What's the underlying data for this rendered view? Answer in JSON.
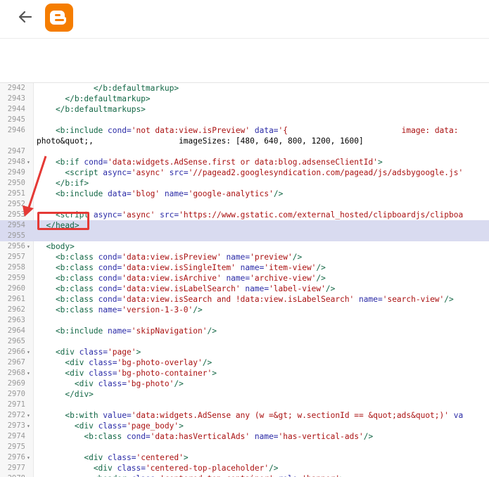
{
  "header": {
    "back_icon": "arrow-left-icon",
    "logo_icon": "blogger-logo-icon",
    "brand_color": "#f57d00"
  },
  "editor": {
    "lines": [
      {
        "n": "2942",
        "fold": false,
        "highlight": false,
        "segments": [
          {
            "t": "            </b:defaultmarkup>",
            "k": "tag"
          }
        ]
      },
      {
        "n": "2943",
        "fold": false,
        "highlight": false,
        "segments": [
          {
            "t": "      </b:defaultmarkup>",
            "k": "tag"
          }
        ]
      },
      {
        "n": "2944",
        "fold": false,
        "highlight": false,
        "segments": [
          {
            "t": "    </b:defaultmarkups>",
            "k": "tag"
          }
        ]
      },
      {
        "n": "2945",
        "fold": false,
        "highlight": false,
        "segments": []
      },
      {
        "n": "2946",
        "fold": false,
        "highlight": false,
        "segments": [
          {
            "t": "    <b:include ",
            "k": "tag"
          },
          {
            "t": "cond=",
            "k": "attr"
          },
          {
            "t": "'not data:view.isPreview'",
            "k": "str"
          },
          {
            "t": " data=",
            "k": "attr"
          },
          {
            "t": "'{                        image: data:",
            "k": "str"
          }
        ]
      },
      {
        "n": "",
        "fold": false,
        "highlight": false,
        "segments": [
          {
            "t": "photo&quot;,                  imageSizes: [480, 640, 800, 1200, 1600]",
            "k": "plain"
          }
        ]
      },
      {
        "n": "2947",
        "fold": false,
        "highlight": false,
        "segments": []
      },
      {
        "n": "2948",
        "fold": true,
        "highlight": false,
        "segments": [
          {
            "t": "    <b:if ",
            "k": "tag"
          },
          {
            "t": "cond=",
            "k": "attr"
          },
          {
            "t": "'data:widgets.AdSense.first or data:blog.adsenseClientId'",
            "k": "str"
          },
          {
            "t": ">",
            "k": "tag"
          }
        ]
      },
      {
        "n": "2949",
        "fold": false,
        "highlight": false,
        "segments": [
          {
            "t": "      <script ",
            "k": "tag"
          },
          {
            "t": "async=",
            "k": "attr"
          },
          {
            "t": "'async'",
            "k": "str"
          },
          {
            "t": " src=",
            "k": "attr"
          },
          {
            "t": "'//pagead2.googlesyndication.com/pagead/js/adsbygoogle.js'",
            "k": "str"
          }
        ]
      },
      {
        "n": "2950",
        "fold": false,
        "highlight": false,
        "segments": [
          {
            "t": "    </b:if>",
            "k": "tag"
          }
        ]
      },
      {
        "n": "2951",
        "fold": false,
        "highlight": false,
        "segments": [
          {
            "t": "    <b:include ",
            "k": "tag"
          },
          {
            "t": "data=",
            "k": "attr"
          },
          {
            "t": "'blog'",
            "k": "str"
          },
          {
            "t": " name=",
            "k": "attr"
          },
          {
            "t": "'google-analytics'",
            "k": "str"
          },
          {
            "t": "/>",
            "k": "tag"
          }
        ]
      },
      {
        "n": "2952",
        "fold": false,
        "highlight": false,
        "segments": []
      },
      {
        "n": "2953",
        "fold": false,
        "highlight": false,
        "segments": [
          {
            "t": "    <script ",
            "k": "tag"
          },
          {
            "t": "async=",
            "k": "attr"
          },
          {
            "t": "'async'",
            "k": "str"
          },
          {
            "t": " src=",
            "k": "attr"
          },
          {
            "t": "'https://www.gstatic.com/external_hosted/clipboardjs/clipboa",
            "k": "str"
          }
        ]
      },
      {
        "n": "2954",
        "fold": false,
        "highlight": true,
        "segments": [
          {
            "t": "  </head>",
            "k": "tag"
          }
        ]
      },
      {
        "n": "2955",
        "fold": false,
        "highlight": true,
        "segments": []
      },
      {
        "n": "2956",
        "fold": true,
        "highlight": false,
        "segments": [
          {
            "t": "  <body>",
            "k": "tag"
          }
        ]
      },
      {
        "n": "2957",
        "fold": false,
        "highlight": false,
        "segments": [
          {
            "t": "    <b:class ",
            "k": "tag"
          },
          {
            "t": "cond=",
            "k": "attr"
          },
          {
            "t": "'data:view.isPreview'",
            "k": "str"
          },
          {
            "t": " name=",
            "k": "attr"
          },
          {
            "t": "'preview'",
            "k": "str"
          },
          {
            "t": "/>",
            "k": "tag"
          }
        ]
      },
      {
        "n": "2958",
        "fold": false,
        "highlight": false,
        "segments": [
          {
            "t": "    <b:class ",
            "k": "tag"
          },
          {
            "t": "cond=",
            "k": "attr"
          },
          {
            "t": "'data:view.isSingleItem'",
            "k": "str"
          },
          {
            "t": " name=",
            "k": "attr"
          },
          {
            "t": "'item-view'",
            "k": "str"
          },
          {
            "t": "/>",
            "k": "tag"
          }
        ]
      },
      {
        "n": "2959",
        "fold": false,
        "highlight": false,
        "segments": [
          {
            "t": "    <b:class ",
            "k": "tag"
          },
          {
            "t": "cond=",
            "k": "attr"
          },
          {
            "t": "'data:view.isArchive'",
            "k": "str"
          },
          {
            "t": " name=",
            "k": "attr"
          },
          {
            "t": "'archive-view'",
            "k": "str"
          },
          {
            "t": "/>",
            "k": "tag"
          }
        ]
      },
      {
        "n": "2960",
        "fold": false,
        "highlight": false,
        "segments": [
          {
            "t": "    <b:class ",
            "k": "tag"
          },
          {
            "t": "cond=",
            "k": "attr"
          },
          {
            "t": "'data:view.isLabelSearch'",
            "k": "str"
          },
          {
            "t": " name=",
            "k": "attr"
          },
          {
            "t": "'label-view'",
            "k": "str"
          },
          {
            "t": "/>",
            "k": "tag"
          }
        ]
      },
      {
        "n": "2961",
        "fold": false,
        "highlight": false,
        "segments": [
          {
            "t": "    <b:class ",
            "k": "tag"
          },
          {
            "t": "cond=",
            "k": "attr"
          },
          {
            "t": "'data:view.isSearch and !data:view.isLabelSearch'",
            "k": "str"
          },
          {
            "t": " name=",
            "k": "attr"
          },
          {
            "t": "'search-view'",
            "k": "str"
          },
          {
            "t": "/>",
            "k": "tag"
          }
        ]
      },
      {
        "n": "2962",
        "fold": false,
        "highlight": false,
        "segments": [
          {
            "t": "    <b:class ",
            "k": "tag"
          },
          {
            "t": "name=",
            "k": "attr"
          },
          {
            "t": "'version-1-3-0'",
            "k": "str"
          },
          {
            "t": "/>",
            "k": "tag"
          }
        ]
      },
      {
        "n": "2963",
        "fold": false,
        "highlight": false,
        "segments": []
      },
      {
        "n": "2964",
        "fold": false,
        "highlight": false,
        "segments": [
          {
            "t": "    <b:include ",
            "k": "tag"
          },
          {
            "t": "name=",
            "k": "attr"
          },
          {
            "t": "'skipNavigation'",
            "k": "str"
          },
          {
            "t": "/>",
            "k": "tag"
          }
        ]
      },
      {
        "n": "2965",
        "fold": false,
        "highlight": false,
        "segments": []
      },
      {
        "n": "2966",
        "fold": true,
        "highlight": false,
        "segments": [
          {
            "t": "    <div ",
            "k": "tag"
          },
          {
            "t": "class=",
            "k": "attr"
          },
          {
            "t": "'page'",
            "k": "str"
          },
          {
            "t": ">",
            "k": "tag"
          }
        ]
      },
      {
        "n": "2967",
        "fold": false,
        "highlight": false,
        "segments": [
          {
            "t": "      <div ",
            "k": "tag"
          },
          {
            "t": "class=",
            "k": "attr"
          },
          {
            "t": "'bg-photo-overlay'",
            "k": "str"
          },
          {
            "t": "/>",
            "k": "tag"
          }
        ]
      },
      {
        "n": "2968",
        "fold": true,
        "highlight": false,
        "segments": [
          {
            "t": "      <div ",
            "k": "tag"
          },
          {
            "t": "class=",
            "k": "attr"
          },
          {
            "t": "'bg-photo-container'",
            "k": "str"
          },
          {
            "t": ">",
            "k": "tag"
          }
        ]
      },
      {
        "n": "2969",
        "fold": false,
        "highlight": false,
        "segments": [
          {
            "t": "        <div ",
            "k": "tag"
          },
          {
            "t": "class=",
            "k": "attr"
          },
          {
            "t": "'bg-photo'",
            "k": "str"
          },
          {
            "t": "/>",
            "k": "tag"
          }
        ]
      },
      {
        "n": "2970",
        "fold": false,
        "highlight": false,
        "segments": [
          {
            "t": "      </div>",
            "k": "tag"
          }
        ]
      },
      {
        "n": "2971",
        "fold": false,
        "highlight": false,
        "segments": []
      },
      {
        "n": "2972",
        "fold": true,
        "highlight": false,
        "segments": [
          {
            "t": "      <b:with ",
            "k": "tag"
          },
          {
            "t": "value=",
            "k": "attr"
          },
          {
            "t": "'data:widgets.AdSense any (w =&gt; w.sectionId == &quot;ads&quot;)'",
            "k": "str"
          },
          {
            "t": " va",
            "k": "attr"
          }
        ]
      },
      {
        "n": "2973",
        "fold": true,
        "highlight": false,
        "segments": [
          {
            "t": "        <div ",
            "k": "tag"
          },
          {
            "t": "class=",
            "k": "attr"
          },
          {
            "t": "'page_body'",
            "k": "str"
          },
          {
            "t": ">",
            "k": "tag"
          }
        ]
      },
      {
        "n": "2974",
        "fold": false,
        "highlight": false,
        "segments": [
          {
            "t": "          <b:class ",
            "k": "tag"
          },
          {
            "t": "cond=",
            "k": "attr"
          },
          {
            "t": "'data:hasVerticalAds'",
            "k": "str"
          },
          {
            "t": " name=",
            "k": "attr"
          },
          {
            "t": "'has-vertical-ads'",
            "k": "str"
          },
          {
            "t": "/>",
            "k": "tag"
          }
        ]
      },
      {
        "n": "2975",
        "fold": false,
        "highlight": false,
        "segments": []
      },
      {
        "n": "2976",
        "fold": true,
        "highlight": false,
        "segments": [
          {
            "t": "          <div ",
            "k": "tag"
          },
          {
            "t": "class=",
            "k": "attr"
          },
          {
            "t": "'centered'",
            "k": "str"
          },
          {
            "t": ">",
            "k": "tag"
          }
        ]
      },
      {
        "n": "2977",
        "fold": false,
        "highlight": false,
        "segments": [
          {
            "t": "            <div ",
            "k": "tag"
          },
          {
            "t": "class=",
            "k": "attr"
          },
          {
            "t": "'centered-top-placeholder'",
            "k": "str"
          },
          {
            "t": "/>",
            "k": "tag"
          }
        ]
      },
      {
        "n": "2978",
        "fold": true,
        "highlight": false,
        "segments": [
          {
            "t": "            <header ",
            "k": "tag"
          },
          {
            "t": "class=",
            "k": "attr"
          },
          {
            "t": "'centered-top-container'",
            "k": "str"
          },
          {
            "t": " role=",
            "k": "attr"
          },
          {
            "t": "'banner'",
            "k": "str"
          },
          {
            "t": ">",
            "k": "tag"
          }
        ]
      }
    ]
  },
  "annotation": {
    "color": "#e53935",
    "arrow_icon": "red-arrow-icon"
  }
}
